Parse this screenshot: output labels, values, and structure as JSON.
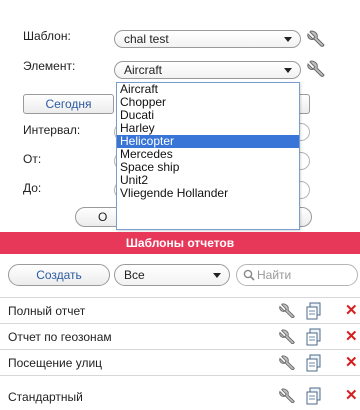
{
  "form": {
    "template_label": "Шаблон:",
    "template_value": "chal test",
    "element_label": "Элемент:",
    "element_value": "Aircraft",
    "today_button": "Сегодня",
    "interval_label": "Интервал:",
    "from_label": "От:",
    "to_label": "До:",
    "hidden_button_fragment": "О"
  },
  "dropdown": {
    "options": [
      "Aircraft",
      "Chopper",
      "Ducati",
      "Harley",
      "Helicopter",
      "Mercedes",
      "Space ship",
      "Unit2",
      "Vliegende Hollander"
    ],
    "highlighted": "Helicopter"
  },
  "reports": {
    "banner": "Шаблоны отчетов",
    "create_button": "Создать",
    "filter_value": "Все",
    "search_placeholder": "Найти",
    "items": [
      {
        "name": "Полный отчет"
      },
      {
        "name": "Отчет по геозонам"
      },
      {
        "name": "Посещение улиц"
      },
      {
        "name": "Стандартный"
      }
    ]
  },
  "colors": {
    "accent": "#e8385a",
    "highlight": "#3875d7",
    "delete": "#d71e1e",
    "link": "#2b5aa0"
  },
  "icons": {
    "settings": "wrench-icon",
    "copy": "copy-icon",
    "delete": "delete-x-icon",
    "search": "search-icon"
  }
}
